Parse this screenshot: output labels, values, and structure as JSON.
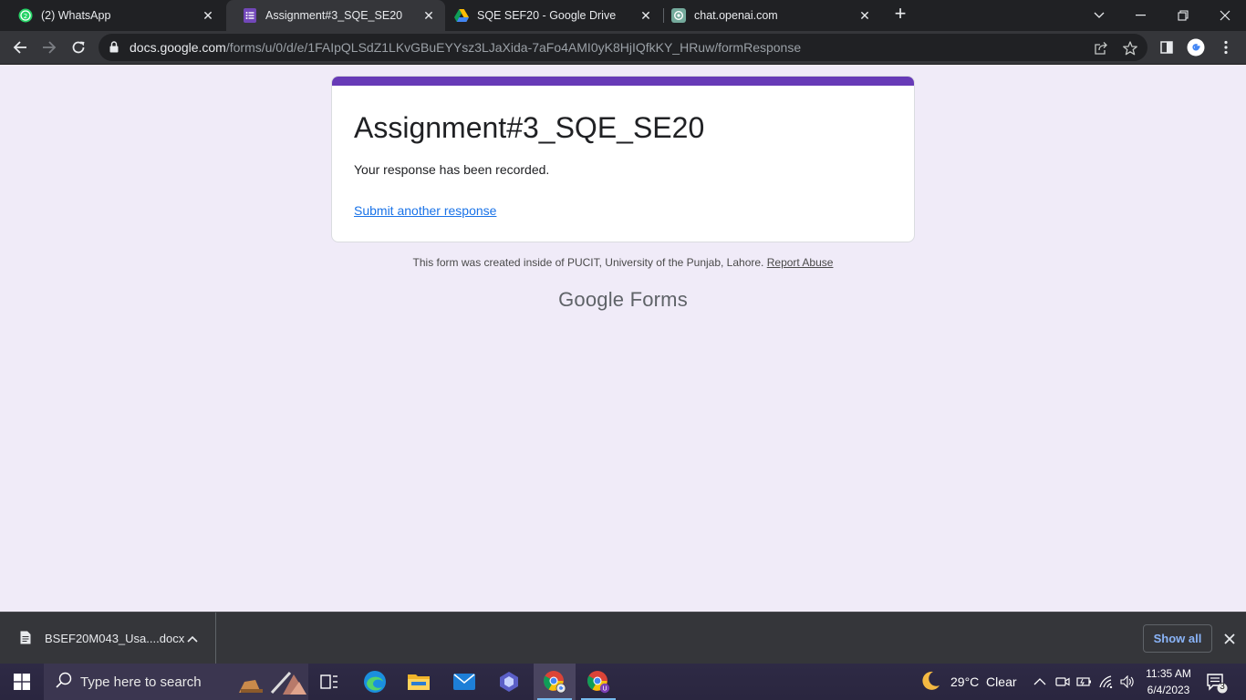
{
  "browser": {
    "tabs": [
      {
        "title": "(2) WhatsApp",
        "icon": "whatsapp-icon",
        "active": false
      },
      {
        "title": "Assignment#3_SQE_SE20",
        "icon": "google-forms-icon",
        "active": true
      },
      {
        "title": "SQE SEF20 - Google Drive",
        "icon": "google-drive-icon",
        "active": false
      },
      {
        "title": "chat.openai.com",
        "icon": "openai-icon",
        "active": false
      }
    ],
    "url_host": "docs.google.com",
    "url_path": "/forms/u/0/d/e/1FAIpQLSdZ1LKvGBuEYYsz3LJaXida-7aFo4AMI0yK8HjIQfkKY_HRuw/formResponse"
  },
  "form": {
    "title": "Assignment#3_SQE_SE20",
    "confirmation": "Your response has been recorded.",
    "submit_another": "Submit another response",
    "footer_text": "This form was created inside of PUCIT, University of the Punjab, Lahore.",
    "report_abuse": "Report Abuse",
    "brand_google": "Google",
    "brand_forms": "Forms",
    "accent_color": "#673ab7"
  },
  "downloads": {
    "file_name": "BSEF20M043_Usa....docx",
    "show_all": "Show all"
  },
  "taskbar": {
    "search_placeholder": "Type here to search",
    "weather": "29°C  Clear",
    "time": "11:35 AM",
    "date": "6/4/2023",
    "notification_count": "3"
  }
}
